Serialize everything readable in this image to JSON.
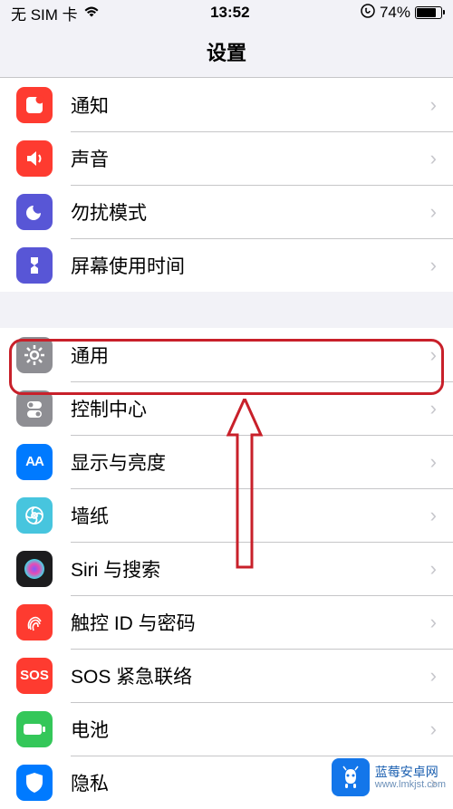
{
  "status": {
    "carrier": "无 SIM 卡",
    "time": "13:52",
    "battery_pct": "74%"
  },
  "header": {
    "title": "设置"
  },
  "sections": [
    {
      "rows": [
        {
          "label": "通知",
          "icon": "notification-icon"
        },
        {
          "label": "声音",
          "icon": "sound-icon"
        },
        {
          "label": "勿扰模式",
          "icon": "do-not-disturb-icon"
        },
        {
          "label": "屏幕使用时间",
          "icon": "screen-time-icon"
        }
      ]
    },
    {
      "rows": [
        {
          "label": "通用",
          "icon": "general-icon",
          "highlighted": true
        },
        {
          "label": "控制中心",
          "icon": "control-center-icon"
        },
        {
          "label": "显示与亮度",
          "icon": "display-brightness-icon"
        },
        {
          "label": "墙纸",
          "icon": "wallpaper-icon"
        },
        {
          "label": "Siri 与搜索",
          "icon": "siri-icon"
        },
        {
          "label": "触控 ID 与密码",
          "icon": "touchid-icon"
        },
        {
          "label": "SOS 紧急联络",
          "icon": "sos-icon"
        },
        {
          "label": "电池",
          "icon": "battery-icon"
        },
        {
          "label": "隐私",
          "icon": "privacy-icon"
        }
      ]
    }
  ],
  "watermark": {
    "name": "蓝莓安卓网",
    "url": "www.lmkjst.com"
  },
  "sos_text": "SOS"
}
